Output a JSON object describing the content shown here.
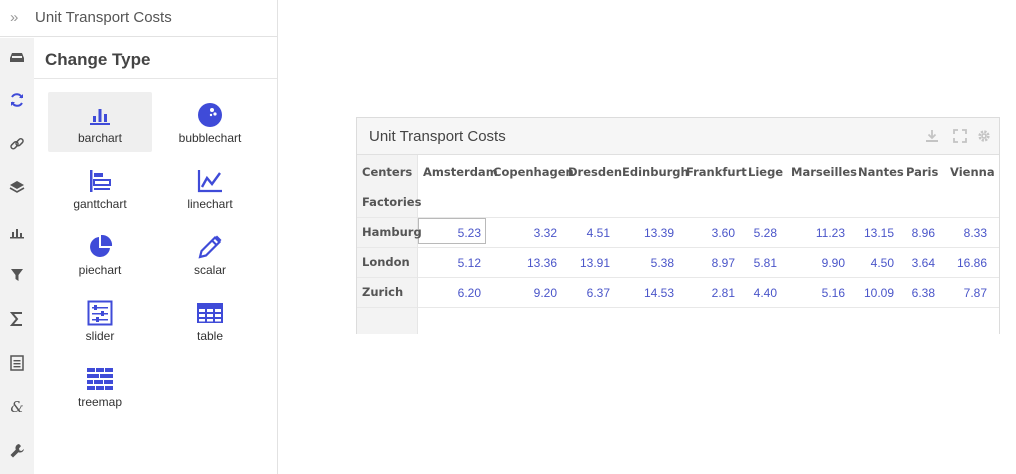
{
  "sidebar": {
    "collapse_icon": "chevrons-right-icon",
    "title": "Unit Transport Costs",
    "rail_icons": [
      "inbox-icon",
      "refresh-icon",
      "link-icon",
      "layers-icon",
      "bar-chart-icon",
      "filter-icon",
      "sigma-icon",
      "list-icon",
      "ampersand-icon",
      "wrench-icon"
    ],
    "section_title": "Change Type",
    "types": [
      {
        "label": "barchart",
        "icon": "barchart-icon"
      },
      {
        "label": "bubblechart",
        "icon": "bubblechart-icon"
      },
      {
        "label": "ganttchart",
        "icon": "ganttchart-icon"
      },
      {
        "label": "linechart",
        "icon": "linechart-icon"
      },
      {
        "label": "piechart",
        "icon": "piechart-icon"
      },
      {
        "label": "scalar",
        "icon": "pencil-icon"
      },
      {
        "label": "slider",
        "icon": "slider-icon"
      },
      {
        "label": "table",
        "icon": "table-icon"
      },
      {
        "label": "treemap",
        "icon": "treemap-icon"
      }
    ],
    "selected_type": "barchart"
  },
  "widget": {
    "title": "Unit Transport Costs",
    "icons": [
      "download-icon",
      "expand-icon",
      "gear-icon"
    ],
    "column_dim": "Centers",
    "row_dim": "Factories",
    "columns": [
      "Amsterdam",
      "Copenhagen",
      "Dresden",
      "Edinburgh",
      "Frankfurt",
      "Liege",
      "Marseilles",
      "Nantes",
      "Paris",
      "Vienna"
    ],
    "rows": [
      {
        "label": "Hamburg",
        "values": [
          "5.23",
          "3.32",
          "4.51",
          "13.39",
          "3.60",
          "5.28",
          "11.23",
          "13.15",
          "8.96",
          "8.33"
        ]
      },
      {
        "label": "London",
        "values": [
          "5.12",
          "13.36",
          "13.91",
          "5.38",
          "8.97",
          "5.81",
          "9.90",
          "4.50",
          "3.64",
          "16.86"
        ]
      },
      {
        "label": "Zurich",
        "values": [
          "6.20",
          "9.20",
          "6.37",
          "14.53",
          "2.81",
          "4.40",
          "5.16",
          "10.09",
          "6.38",
          "7.87"
        ]
      }
    ],
    "accent_color": "#3f4bd8"
  }
}
